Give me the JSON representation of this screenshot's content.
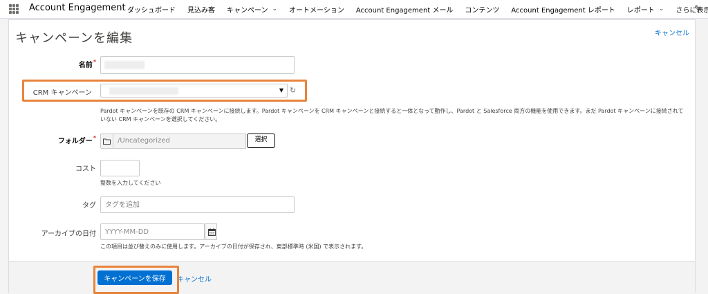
{
  "app": {
    "name": "Account Engagement"
  },
  "nav": {
    "items": [
      {
        "label": "ダッシュボード",
        "dropdown": false
      },
      {
        "label": "見込み客",
        "dropdown": false
      },
      {
        "label": "キャンペーン",
        "dropdown": true
      },
      {
        "label": "オートメーション",
        "dropdown": false
      },
      {
        "label": "Account Engagement メール",
        "dropdown": false
      },
      {
        "label": "コンテンツ",
        "dropdown": false
      },
      {
        "label": "Account Engagement レポート",
        "dropdown": false
      },
      {
        "label": "レポート",
        "dropdown": true
      },
      {
        "label": "さらに表示",
        "dropdown": true
      }
    ]
  },
  "page": {
    "title": "キャンペーンを編集",
    "cancel_top": "キャンセル"
  },
  "form": {
    "name_label": "名前",
    "required_mark": "*",
    "crm_label": "CRM キャンペーン",
    "crm_help": "Pardot キャンペーンを既存の CRM キャンペーンに接続します。Pardot キャンペーンを CRM キャンペーンと接続すると一体となって動作し、Pardot と Salesforce 両方の機能を使用できます。まだ Pardot キャンペーンに接続されていない CRM キャンペーンを選択してください。",
    "folder_label": "フォルダー",
    "folder_path": "/Uncategorized",
    "folder_select": "選択",
    "cost_label": "コスト",
    "cost_help": "整数を入力してください",
    "tag_label": "タグ",
    "tag_placeholder": "タグを追加",
    "archive_label": "アーカイブの日付",
    "archive_placeholder": "YYYY-MM-DD",
    "archive_help": "この項目は並び替えのみに使用します。アーカイブの日付が保存され、東部標準時 (米国) で表示されます。"
  },
  "footer": {
    "save_label": "キャンペーンを保存",
    "cancel_label": "キャンセル"
  },
  "colors": {
    "brand_blue": "#0070d2",
    "highlight_orange": "#e8833a",
    "required_red": "#c23934"
  }
}
